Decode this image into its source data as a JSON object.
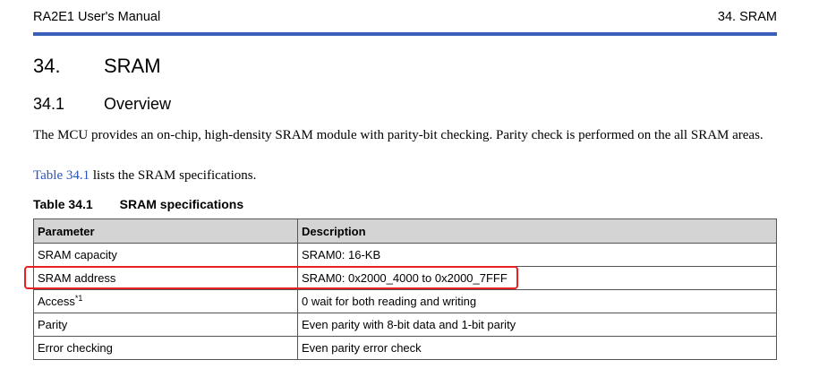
{
  "header": {
    "manual_title": "RA2E1 User's Manual",
    "section_ref": "34. SRAM"
  },
  "chapter": {
    "number": "34.",
    "title": "SRAM"
  },
  "section": {
    "number": "34.1",
    "title": "Overview"
  },
  "body": {
    "paragraph1": "The MCU provides an on-chip, high-density SRAM module with parity-bit checking. Parity check is performed on the all SRAM areas.",
    "paragraph2_link": "Table 34.1",
    "paragraph2_rest": " lists the SRAM specifications."
  },
  "table": {
    "caption_number": "Table 34.1",
    "caption_title": "SRAM specifications",
    "headers": [
      "Parameter",
      "Description"
    ],
    "rows": [
      {
        "param": "SRAM capacity",
        "note": "",
        "desc": "SRAM0: 16-KB"
      },
      {
        "param": "SRAM address",
        "note": "",
        "desc": "SRAM0: 0x2000_4000 to 0x2000_7FFF"
      },
      {
        "param": "Access",
        "note": "*1",
        "desc": "0 wait for both reading and writing"
      },
      {
        "param": "Parity",
        "note": "",
        "desc": "Even parity with 8-bit data and 1-bit parity"
      },
      {
        "param": "Error checking",
        "note": "",
        "desc": "Even parity error check"
      }
    ]
  },
  "highlight": {
    "color": "#e82020",
    "row": "SRAM address"
  },
  "colors": {
    "header_rule": "#3a5fb8",
    "link": "#2a55c0",
    "table_header_bg": "#d4d4d4"
  }
}
